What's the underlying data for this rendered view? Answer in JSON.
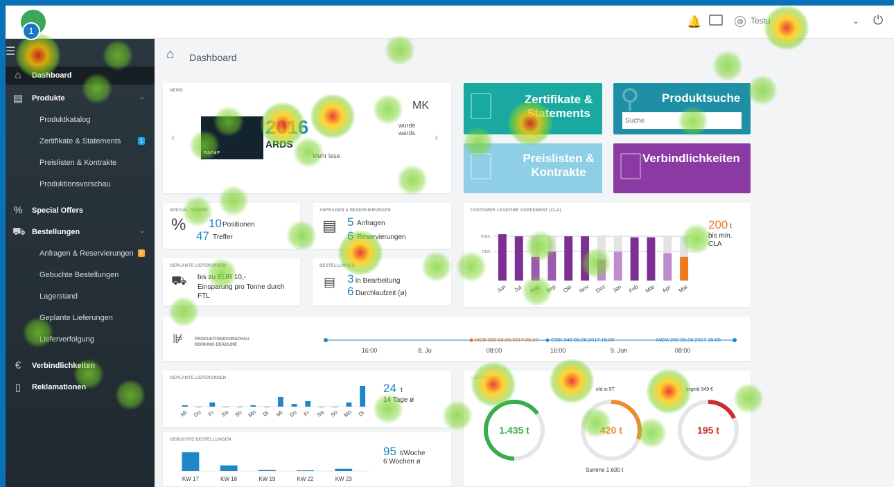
{
  "topbar": {
    "user_name": "Testu",
    "annotation_number": "1"
  },
  "sidebar": {
    "items": [
      {
        "label": "Dashboard",
        "icon": "home-icon"
      },
      {
        "label": "Produkte",
        "icon": "book-icon"
      },
      {
        "label": "Produktkatalog"
      },
      {
        "label": "Zertifikate & Statements",
        "badge": "1"
      },
      {
        "label": "Preislisten & Kontrakte"
      },
      {
        "label": "Produktionsvorschau"
      },
      {
        "label": "Special Offers",
        "icon": "percent-icon"
      },
      {
        "label": "Bestellungen",
        "icon": "truck-icon"
      },
      {
        "label": "Anfragen & Reservierungen",
        "badge": "2"
      },
      {
        "label": "Gebuchte Bestellungen"
      },
      {
        "label": "Lagerstand"
      },
      {
        "label": "Geplante Lieferungen"
      },
      {
        "label": "Lieferverfolgung"
      },
      {
        "label": "Verbindlichkeiten",
        "icon": "euro-icon"
      },
      {
        "label": "Reklamationen",
        "icon": "document-icon"
      }
    ]
  },
  "page": {
    "title": "Dashboard"
  },
  "news": {
    "title": "NEWS",
    "heading": "MK",
    "year": "2016",
    "awards": "ARDS",
    "logo_text": "PULP & P",
    "body1": "wurde",
    "body2": "wards",
    "more": "Mehr lese"
  },
  "tiles": {
    "zertifikate": "Zertifikate & Statements",
    "produktsuche": "Produktsuche",
    "search_placeholder": "Suche",
    "preislisten": "Preislisten & Kontrakte",
    "verbindlichkeiten": "Verbindlichkeiten"
  },
  "special": {
    "title": "SPECIAL OFFERS",
    "positions_num": "10",
    "positions_label": "Positionen",
    "hits_num": "47",
    "hits_label": "Treffer"
  },
  "anfragen": {
    "title": "ANFRAGEN & RESERVIERUNGEN",
    "requests_num": "5",
    "requests_label": "Anfragen",
    "reservations_num": "6",
    "reservations_label": "Reservierungen"
  },
  "geplante_top": {
    "title": "GEPLANTE LIEFERUNGEN",
    "line1": "bis zu EUR 10,-",
    "line2": "Einsparung pro Tonne durch",
    "line3": "FTL"
  },
  "bearbeitung": {
    "title": "BESTELLUNGEN",
    "inwork_num": "3",
    "inwork_label": "in Bearbeitung",
    "lead_num": "6",
    "lead_label": "Durchlaufzeit (ø)"
  },
  "cla": {
    "title": "CUSTOMER LEADTIME AGREEMENT (CLA)",
    "value": "200",
    "unit": "t",
    "sub1": "bis min.",
    "sub2": "CLA",
    "max_label": "max.",
    "min_label": "min."
  },
  "chart_data": [
    {
      "type": "bar",
      "title": "CUSTOMER LEADTIME AGREEMENT (CLA)",
      "categories": [
        "Jun",
        "Jul",
        "Aug",
        "Sep",
        "Okt",
        "Nov",
        "Dez",
        "Jän",
        "Feb",
        "Mär",
        "Apr",
        "Mai"
      ],
      "series": [
        {
          "values": [
            88,
            84,
            45,
            55,
            84,
            84,
            40,
            55,
            82,
            82,
            52,
            45
          ]
        }
      ],
      "capacity": [
        88,
        84,
        84,
        84,
        84,
        84,
        84,
        84,
        84,
        84,
        84,
        84
      ],
      "ylim": [
        0,
        100
      ]
    },
    {
      "type": "bar",
      "title": "GEPLANTE LIEFERUNGEN",
      "categories": [
        "Mi",
        "Do",
        "Fr",
        "Sa",
        "So",
        "Mo",
        "Di",
        "Mi",
        "Do",
        "Fr",
        "Sa",
        "So",
        "Mo",
        "Di"
      ],
      "values": [
        1,
        0,
        3,
        0,
        0,
        1,
        0,
        7,
        2,
        4,
        0,
        0,
        3,
        15
      ],
      "ylim": [
        0,
        16
      ]
    },
    {
      "type": "bar",
      "title": "GEBUCHTE BESTELLUNGEN",
      "categories": [
        "KW 17",
        "KW 18",
        "KW 19",
        "KW 22",
        "KW 23"
      ],
      "values": [
        50,
        15,
        3,
        2,
        6
      ],
      "ylim": [
        0,
        55
      ]
    }
  ],
  "timeline": {
    "title1": "PRODUKTIONSVORSCHAU",
    "title2": "BOOKING DEADLINE",
    "times": [
      "16:00",
      "8. Ju",
      "08:00",
      "16:00",
      "9. Jun",
      "08:00"
    ],
    "event_orange": "MCB 350 08.06.2017 05:00",
    "event_blue1": "GRK 340 08.06.2017 15:00",
    "event_blue2": "MCM 200 09.06.2017 15:00"
  },
  "geplante_bottom": {
    "title": "GEPLANTE LIEFERUNGEN",
    "value": "24",
    "unit": "t",
    "sub": "14 Tage ø"
  },
  "gebuchte": {
    "title": "GEBUCHTE BESTELLUNGEN",
    "value": "95",
    "unit": "t/Woche",
    "sub": "6 Wochen ø"
  },
  "lager": {
    "title": "LAGERSTAND",
    "label2": "eld in 5T",
    "label3": "ergeld 949 €",
    "v1": "1.435 t",
    "v2": "420 t",
    "v3": "195 t",
    "sum": "Summe 1.630 t",
    "fractions": [
      0.65,
      0.3,
      0.18
    ],
    "colors": [
      "#3aad4b",
      "#f08a2c",
      "#c9302c"
    ]
  }
}
